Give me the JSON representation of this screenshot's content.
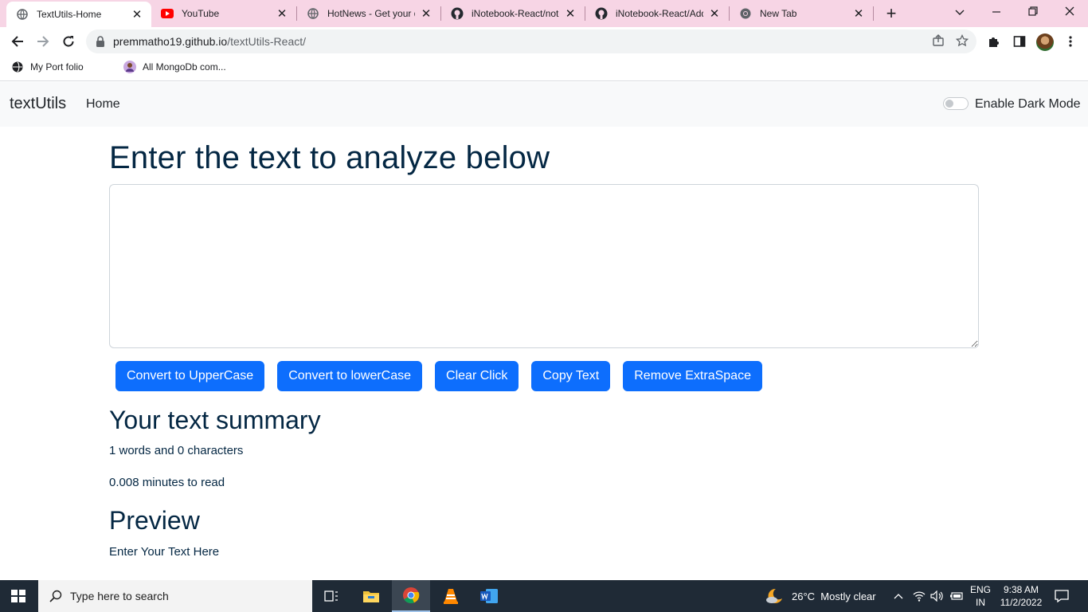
{
  "browser": {
    "tabs": [
      {
        "title": "TextUtils-Home",
        "favicon": "globe-icon",
        "active": true
      },
      {
        "title": "YouTube",
        "favicon": "youtube-icon",
        "active": false
      },
      {
        "title": "HotNews - Get your d",
        "favicon": "globe-icon",
        "active": false
      },
      {
        "title": "iNotebook-React/note",
        "favicon": "github-icon",
        "active": false
      },
      {
        "title": "iNotebook-React/Add",
        "favicon": "github-icon",
        "active": false
      },
      {
        "title": "New Tab",
        "favicon": "chrome-icon",
        "active": false
      }
    ],
    "url_host": "premmatho19.github.io",
    "url_path": "/textUtils-React/",
    "bookmarks": [
      {
        "label": "My Port folio",
        "icon": "globe-icon"
      },
      {
        "label": "All MongoDb com...",
        "icon": "avatar-icon"
      }
    ]
  },
  "app": {
    "brand": "textUtils",
    "nav_home": "Home",
    "dark_mode_label": "Enable Dark Mode",
    "heading": "Enter the text to analyze below",
    "textarea_value": "",
    "buttons": {
      "uppercase": "Convert to UpperCase",
      "lowercase": "Convert to lowerCase",
      "clear": "Clear Click",
      "copy": "Copy Text",
      "extraspace": "Remove ExtraSpace"
    },
    "summary_title": "Your text summary",
    "word_count_text": "1 words and 0 characters",
    "read_time_text": "0.008 minutes to read",
    "preview_title": "Preview",
    "preview_text": "Enter Your Text Here",
    "colors": {
      "primary": "#0d6efd",
      "heading": "#042743",
      "navbar_bg": "#f8f9fa"
    }
  },
  "taskbar": {
    "search_placeholder": "Type here to search",
    "weather": "26°C  Mostly clear",
    "lang_top": "ENG",
    "lang_bottom": "IN",
    "time": "9:38 AM",
    "date": "11/2/2022"
  }
}
